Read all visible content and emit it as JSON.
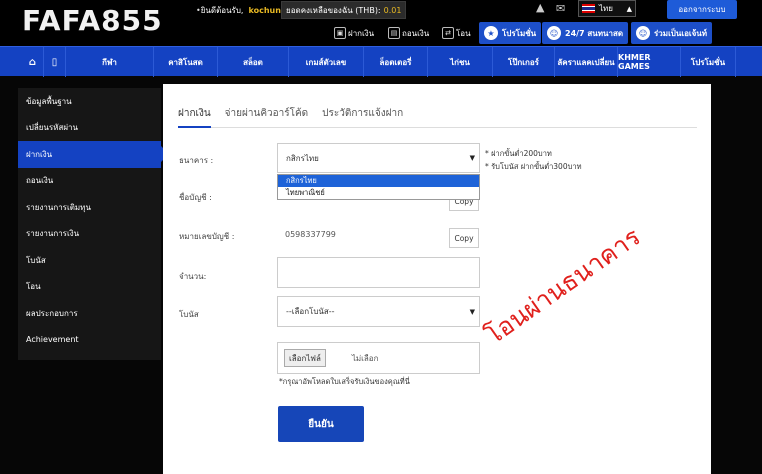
{
  "header": {
    "logo": "FAFA855",
    "welcome": "ยินดีต้อนรับ,",
    "username": "kochun",
    "balance_label": "ยอดคงเหลือของฉัน (THB):",
    "balance_value": "0.01",
    "language": "ไทย",
    "logout_label": "ออกจากระบบ",
    "quick_links": [
      "ฝากเงิน",
      "ถอนเงิน",
      "โอน"
    ],
    "promo_buttons": [
      "โปรโมชั่น",
      "24/7 สนทนาสด",
      "ร่วมเป็นเอเจ้นท์"
    ]
  },
  "nav": {
    "items": [
      "กีฬา",
      "คาสิโนสด",
      "สล็อต",
      "เกมส์ตัวเลข",
      "ล็อตเตอรี่",
      "ไก่ชน",
      "โป๊กเกอร์",
      "ลัคราแลคเปลี่ยน",
      "KHMER GAMES",
      "โปรโมชั่น"
    ]
  },
  "sidebar": {
    "items": [
      {
        "label": "ข้อมูลพื้นฐาน"
      },
      {
        "label": "เปลี่ยนรหัสผ่าน"
      },
      {
        "label": "ฝากเงิน"
      },
      {
        "label": "ถอนเงิน"
      },
      {
        "label": "รายงานการเติมทุน"
      },
      {
        "label": "รายงานการเงิน"
      },
      {
        "label": "โบนัส"
      },
      {
        "label": "โอน"
      },
      {
        "label": "ผลประกอบการ"
      },
      {
        "label": "Achievement"
      }
    ]
  },
  "tabs": [
    "ฝากเงิน",
    "จ่ายผ่านคิวอาร์โค้ด",
    "ประวัติการแจ้งฝาก"
  ],
  "form": {
    "bank_label": "ธนาคาร :",
    "bank_selected": "กสิกรไทย",
    "bank_options": [
      "กสิกรไทย",
      "ไทยพาณิชย์"
    ],
    "notes": [
      "* ฝากขั้นต่ำ200บาท",
      "* รับโบนัส ฝากขั้นต่ำ300บาท"
    ],
    "account_name_label": "ชื่อบัญชี :",
    "account_number_label": "หมายเลขบัญชี :",
    "account_number": "0598337799",
    "copy_label": "Copy",
    "amount_label": "จำนวน:",
    "amount_value": "",
    "bonus_label": "โบนัส",
    "bonus_selected": "--เลือกโบนัส--",
    "file_button": "เลือกไฟล์",
    "file_status": "ไม่เลือก",
    "hint": "*กรุณาอัพโหลดใบเสร็จรับเงินของคุณที่นี่",
    "confirm_label": "ยืนยัน"
  },
  "annotation": {
    "text": "โอนผ่านธนาคาร",
    "color": "#e0201c"
  },
  "colors": {
    "nav_blue": "#1442c2",
    "accent_gold": "#e8b923"
  }
}
